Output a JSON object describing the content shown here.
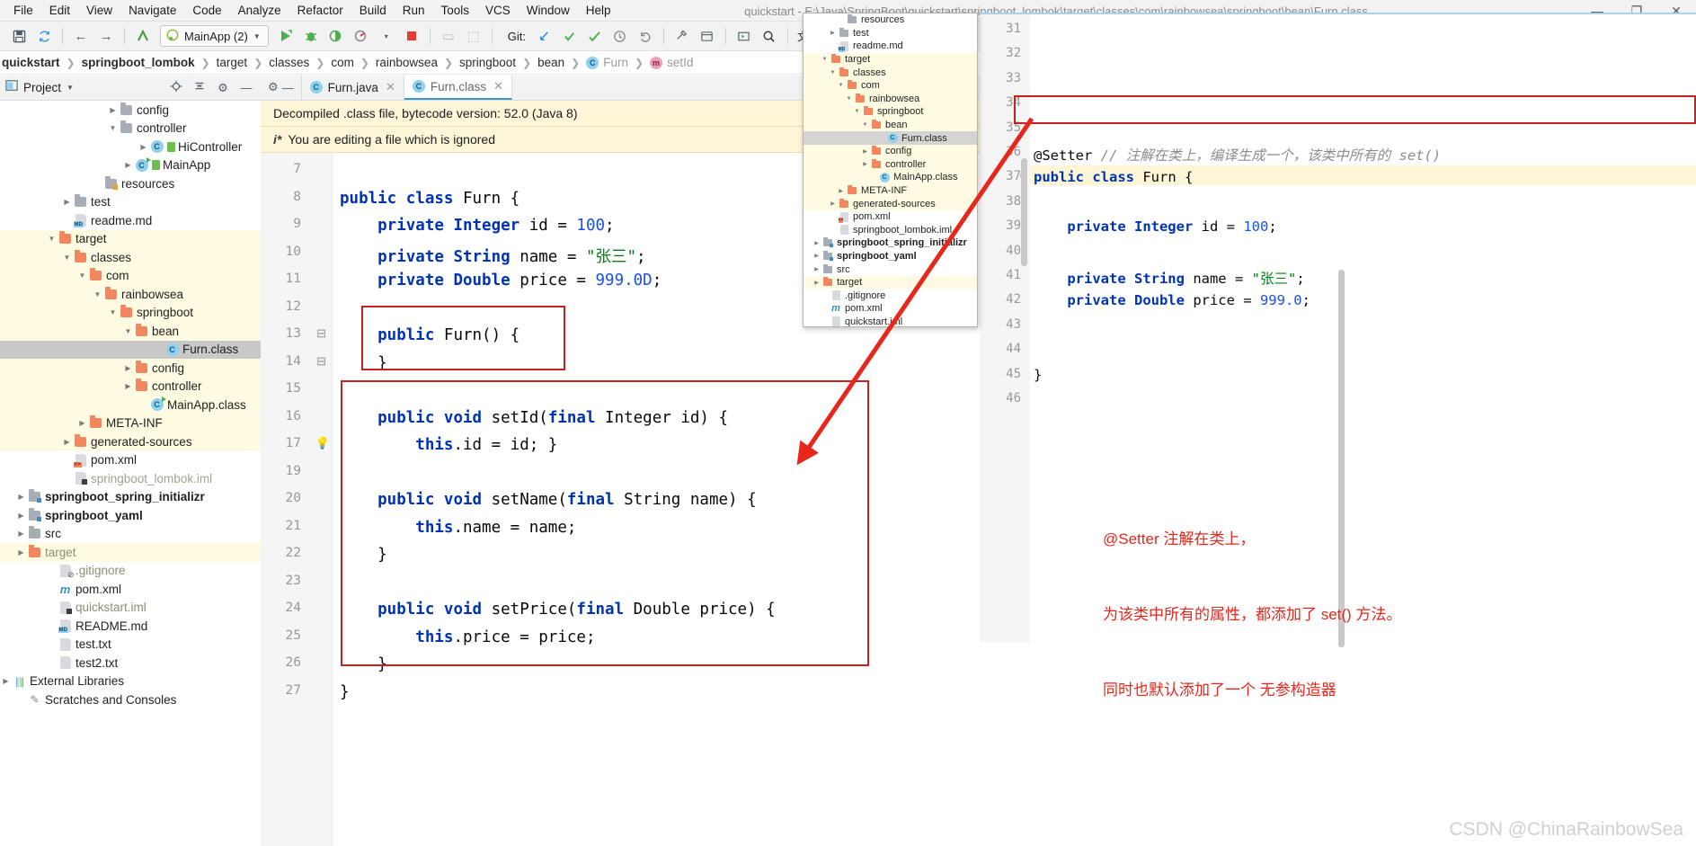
{
  "window": {
    "title": "quickstart - E:\\Java\\SpringBoot\\quickstart\\springboot_lombok\\target\\classes\\com\\rainbowsea\\springboot\\bean\\Furn.class",
    "minimize": "—",
    "maximize": "❐",
    "close": "✕"
  },
  "menubar": {
    "items": [
      {
        "label": "File"
      },
      {
        "label": "Edit"
      },
      {
        "label": "View"
      },
      {
        "label": "Navigate"
      },
      {
        "label": "Code"
      },
      {
        "label": "Analyze"
      },
      {
        "label": "Refactor"
      },
      {
        "label": "Build"
      },
      {
        "label": "Run"
      },
      {
        "label": "Tools"
      },
      {
        "label": "VCS"
      },
      {
        "label": "Window"
      },
      {
        "label": "Help"
      }
    ]
  },
  "toolbar": {
    "save_icon": "💾",
    "sync_icon": "↻",
    "back_icon": "←",
    "forward_icon": "→",
    "build_icon": "↖",
    "run_config": "MainApp (2)",
    "run_config_caret": "▼",
    "run_icon": "▶",
    "debug_icon": "🐞",
    "run_coverage_icon": "◑",
    "profile_icon": "◴",
    "profile_caret": "▾",
    "stop_icon": "■",
    "device_icon": "▭",
    "package_icon": "⬚",
    "git_label": "Git:",
    "git_update_icon": "↙",
    "git_commit_icon": "✓",
    "git_push_icon": "✔",
    "git_history_icon": "◷",
    "git_revert_icon": "↶",
    "search_everywhere_icon": "🔍",
    "settings_icon": "🔧",
    "layout_icon": "▤",
    "preview_icon": "▷",
    "translate_icon": "文"
  },
  "breadcrumb": {
    "items": [
      {
        "label": "quickstart",
        "bold": true,
        "icon": ""
      },
      {
        "label": "springboot_lombok",
        "bold": true,
        "icon": ""
      },
      {
        "label": "target",
        "bold": false,
        "icon": ""
      },
      {
        "label": "classes",
        "bold": false,
        "icon": ""
      },
      {
        "label": "com",
        "bold": false,
        "icon": ""
      },
      {
        "label": "rainbowsea",
        "bold": false,
        "icon": ""
      },
      {
        "label": "springboot",
        "bold": false,
        "icon": ""
      },
      {
        "label": "bean",
        "bold": false,
        "icon": ""
      },
      {
        "label": "Furn",
        "bold": false,
        "icon": "class-icon"
      },
      {
        "label": "setId",
        "bold": false,
        "icon": "method-icon"
      }
    ],
    "separator": "❯"
  },
  "sidebar": {
    "header": {
      "title": "Project",
      "caret": "▼",
      "locate_icon": "⊕",
      "collapse_icon": "⨍",
      "settings_icon": "⚙",
      "hide_icon": "—"
    },
    "items": [
      {
        "label": "config",
        "indent": 7,
        "arrow": "▶",
        "icon": "folder-gray",
        "hl": false
      },
      {
        "label": "controller",
        "indent": 7,
        "arrow": "▼",
        "icon": "folder-gray",
        "hl": false
      },
      {
        "label": "HiController",
        "indent": 9,
        "arrow": "▶",
        "icon": "class",
        "hl": false,
        "green": true
      },
      {
        "label": "MainApp",
        "indent": 8,
        "arrow": "▶",
        "icon": "class-run",
        "hl": false,
        "green": true
      },
      {
        "label": "resources",
        "indent": 6,
        "arrow": "",
        "icon": "folder-res",
        "hl": false
      },
      {
        "label": "test",
        "indent": 4,
        "arrow": "▶",
        "icon": "folder-gray",
        "hl": false
      },
      {
        "label": "readme.md",
        "indent": 4,
        "arrow": "",
        "icon": "doc-md",
        "hl": false
      },
      {
        "label": "target",
        "indent": 3,
        "arrow": "▼",
        "icon": "folder-orange",
        "hl": true
      },
      {
        "label": "classes",
        "indent": 4,
        "arrow": "▼",
        "icon": "folder-orange",
        "hl": true
      },
      {
        "label": "com",
        "indent": 5,
        "arrow": "▼",
        "icon": "folder-orange",
        "hl": true
      },
      {
        "label": "rainbowsea",
        "indent": 6,
        "arrow": "▼",
        "icon": "folder-orange",
        "hl": true
      },
      {
        "label": "springboot",
        "indent": 7,
        "arrow": "▼",
        "icon": "folder-orange",
        "hl": true
      },
      {
        "label": "bean",
        "indent": 8,
        "arrow": "▼",
        "icon": "folder-orange",
        "hl": true
      },
      {
        "label": "Furn.class",
        "indent": 10,
        "arrow": "",
        "icon": "class",
        "sel": true
      },
      {
        "label": "config",
        "indent": 8,
        "arrow": "▶",
        "icon": "folder-orange",
        "hl": true
      },
      {
        "label": "controller",
        "indent": 8,
        "arrow": "▶",
        "icon": "folder-orange",
        "hl": true
      },
      {
        "label": "MainApp.class",
        "indent": 9,
        "arrow": "",
        "icon": "class-run",
        "hl": true
      },
      {
        "label": "META-INF",
        "indent": 5,
        "arrow": "▶",
        "icon": "folder-orange",
        "hl": true
      },
      {
        "label": "generated-sources",
        "indent": 4,
        "arrow": "▶",
        "icon": "folder-orange",
        "hl": true
      },
      {
        "label": "pom.xml",
        "indent": 4,
        "arrow": "",
        "icon": "doc-xml",
        "hl": false
      },
      {
        "label": "springboot_lombok.iml",
        "indent": 4,
        "arrow": "",
        "icon": "doc-iml",
        "hl": false,
        "dim": true
      },
      {
        "label": "springboot_spring_initializr",
        "indent": 1,
        "arrow": "▶",
        "icon": "folder-mod",
        "hl": false,
        "bold": true
      },
      {
        "label": "springboot_yaml",
        "indent": 1,
        "arrow": "▶",
        "icon": "folder-mod",
        "hl": false,
        "bold": true
      },
      {
        "label": "src",
        "indent": 1,
        "arrow": "▶",
        "icon": "folder-gray",
        "hl": false
      },
      {
        "label": "target",
        "indent": 1,
        "arrow": "▶",
        "icon": "folder-orange",
        "hl": true,
        "gray": true
      },
      {
        "label": ".gitignore",
        "indent": 3,
        "arrow": "",
        "icon": "doc-git",
        "hl": false,
        "gray": true
      },
      {
        "label": "pom.xml",
        "indent": 3,
        "arrow": "",
        "icon": "maven",
        "hl": false
      },
      {
        "label": "quickstart.iml",
        "indent": 3,
        "arrow": "",
        "icon": "doc-iml",
        "hl": false,
        "gray": true
      },
      {
        "label": "README.md",
        "indent": 3,
        "arrow": "",
        "icon": "doc-md",
        "hl": false
      },
      {
        "label": "test.txt",
        "indent": 3,
        "arrow": "",
        "icon": "doc-txt",
        "hl": false
      },
      {
        "label": "test2.txt",
        "indent": 3,
        "arrow": "",
        "icon": "doc-txt",
        "hl": false
      },
      {
        "label": "External Libraries",
        "indent": 0,
        "arrow": "▶",
        "icon": "library",
        "hl": false
      },
      {
        "label": "Scratches and Consoles",
        "indent": 1,
        "arrow": "",
        "icon": "scratch",
        "hl": false
      }
    ]
  },
  "editor": {
    "tabs": [
      {
        "label": "Furn.java",
        "icon": "class-icon",
        "active": false,
        "close": "✕"
      },
      {
        "label": "Furn.class",
        "icon": "class-icon",
        "active": true,
        "close": "✕"
      }
    ],
    "banners": [
      {
        "text": "Decompiled .class file, bytecode version: 52.0 (Java 8)",
        "icon": ""
      },
      {
        "text": "You are editing a file which is ignored",
        "icon": "i*"
      }
    ],
    "line_numbers": [
      "7",
      "8",
      "9",
      "10",
      "11",
      "12",
      "13",
      "14",
      "15",
      "16",
      "17",
      "19",
      "20",
      "21",
      "22",
      "23",
      "24",
      "25",
      "26",
      "27"
    ],
    "code_lines": [
      {
        "n": "7",
        "text": "",
        "tokens": []
      },
      {
        "n": "8",
        "tokens": [
          {
            "t": "public ",
            "c": "kw"
          },
          {
            "t": "class ",
            "c": "kw"
          },
          {
            "t": "Furn {",
            "c": "mth"
          }
        ]
      },
      {
        "n": "9",
        "tokens": [
          {
            "t": "    private ",
            "c": "kw"
          },
          {
            "t": "Integer ",
            "c": "kw"
          },
          {
            "t": "id = ",
            "c": "mth"
          },
          {
            "t": "100",
            "c": "num"
          },
          {
            "t": ";",
            "c": "mth"
          }
        ]
      },
      {
        "n": "10",
        "tokens": [
          {
            "t": "    private ",
            "c": "kw"
          },
          {
            "t": "String ",
            "c": "kw"
          },
          {
            "t": "name = ",
            "c": "mth"
          },
          {
            "t": "\"张三\"",
            "c": "str"
          },
          {
            "t": ";",
            "c": "mth"
          }
        ]
      },
      {
        "n": "11",
        "tokens": [
          {
            "t": "    private ",
            "c": "kw"
          },
          {
            "t": "Double ",
            "c": "kw"
          },
          {
            "t": "price = ",
            "c": "mth"
          },
          {
            "t": "999.0D",
            "c": "num"
          },
          {
            "t": ";",
            "c": "mth"
          }
        ]
      },
      {
        "n": "12",
        "tokens": []
      },
      {
        "n": "13",
        "tokens": [
          {
            "t": "    public ",
            "c": "kw"
          },
          {
            "t": "Furn() {",
            "c": "mth"
          }
        ]
      },
      {
        "n": "14",
        "tokens": [
          {
            "t": "    }",
            "c": "mth"
          }
        ]
      },
      {
        "n": "15",
        "tokens": []
      },
      {
        "n": "16",
        "tokens": [
          {
            "t": "    public ",
            "c": "kw"
          },
          {
            "t": "void ",
            "c": "kw"
          },
          {
            "t": "setId(",
            "c": "mth"
          },
          {
            "t": "final ",
            "c": "kw"
          },
          {
            "t": "Integer ",
            "c": "mth"
          },
          {
            "t": "id) {",
            "c": "mth"
          }
        ]
      },
      {
        "n": "17",
        "tokens": [
          {
            "t": "        this",
            "c": "kw"
          },
          {
            "t": ".id = id; }",
            "c": "mth"
          }
        ]
      },
      {
        "n": "19",
        "tokens": []
      },
      {
        "n": "20",
        "tokens": [
          {
            "t": "    public ",
            "c": "kw"
          },
          {
            "t": "void ",
            "c": "kw"
          },
          {
            "t": "setName(",
            "c": "mth"
          },
          {
            "t": "final ",
            "c": "kw"
          },
          {
            "t": "String ",
            "c": "mth"
          },
          {
            "t": "name) {",
            "c": "mth"
          }
        ]
      },
      {
        "n": "21",
        "tokens": [
          {
            "t": "        this",
            "c": "kw"
          },
          {
            "t": ".name = name;",
            "c": "mth"
          }
        ]
      },
      {
        "n": "22",
        "tokens": [
          {
            "t": "    }",
            "c": "mth"
          }
        ]
      },
      {
        "n": "23",
        "tokens": []
      },
      {
        "n": "24",
        "tokens": [
          {
            "t": "    public ",
            "c": "kw"
          },
          {
            "t": "void ",
            "c": "kw"
          },
          {
            "t": "setPrice(",
            "c": "mth"
          },
          {
            "t": "final ",
            "c": "kw"
          },
          {
            "t": "Double ",
            "c": "mth"
          },
          {
            "t": "price) {",
            "c": "mth"
          }
        ]
      },
      {
        "n": "25",
        "tokens": [
          {
            "t": "        this",
            "c": "kw"
          },
          {
            "t": ".price = price;",
            "c": "mth"
          }
        ]
      },
      {
        "n": "26",
        "tokens": [
          {
            "t": "    }",
            "c": "mth"
          }
        ]
      },
      {
        "n": "27",
        "tokens": [
          {
            "t": "}",
            "c": "mth"
          }
        ]
      }
    ],
    "bulb_icon": "💡"
  },
  "popup_tree": {
    "items": [
      {
        "label": "resources",
        "indent": 4,
        "arrow": "",
        "icon": "folder-res",
        "hl": false
      },
      {
        "label": "test",
        "indent": 3,
        "arrow": "▶",
        "icon": "folder-gray",
        "hl": false
      },
      {
        "label": "readme.md",
        "indent": 3,
        "arrow": "",
        "icon": "doc-md",
        "hl": false
      },
      {
        "label": "target",
        "indent": 2,
        "arrow": "▼",
        "icon": "folder-orange",
        "hl": true
      },
      {
        "label": "classes",
        "indent": 3,
        "arrow": "▼",
        "icon": "folder-orange",
        "hl": true
      },
      {
        "label": "com",
        "indent": 4,
        "arrow": "▼",
        "icon": "folder-orange",
        "hl": true
      },
      {
        "label": "rainbowsea",
        "indent": 5,
        "arrow": "▼",
        "icon": "folder-orange",
        "hl": true
      },
      {
        "label": "springboot",
        "indent": 6,
        "arrow": "▼",
        "icon": "folder-orange",
        "hl": true
      },
      {
        "label": "bean",
        "indent": 7,
        "arrow": "▼",
        "icon": "folder-orange",
        "hl": true
      },
      {
        "label": "Furn.class",
        "indent": 9,
        "arrow": "",
        "icon": "class",
        "sel": true
      },
      {
        "label": "config",
        "indent": 7,
        "arrow": "▶",
        "icon": "folder-orange",
        "hl": true
      },
      {
        "label": "controller",
        "indent": 7,
        "arrow": "▶",
        "icon": "folder-orange",
        "hl": true
      },
      {
        "label": "MainApp.class",
        "indent": 8,
        "arrow": "",
        "icon": "class-run",
        "hl": true
      },
      {
        "label": "META-INF",
        "indent": 4,
        "arrow": "▶",
        "icon": "folder-orange",
        "hl": true
      },
      {
        "label": "generated-sources",
        "indent": 3,
        "arrow": "▶",
        "icon": "folder-orange",
        "hl": true
      },
      {
        "label": "pom.xml",
        "indent": 3,
        "arrow": "",
        "icon": "doc-xml",
        "hl": false
      },
      {
        "label": "springboot_lombok.iml",
        "indent": 3,
        "arrow": "",
        "icon": "doc-iml",
        "hl": false
      },
      {
        "label": "springboot_spring_initializr",
        "indent": 1,
        "arrow": "▶",
        "icon": "folder-mod",
        "hl": false,
        "bold": true
      },
      {
        "label": "springboot_yaml",
        "indent": 1,
        "arrow": "▶",
        "icon": "folder-mod",
        "hl": false,
        "bold": true
      },
      {
        "label": "src",
        "indent": 1,
        "arrow": "▶",
        "icon": "folder-gray",
        "hl": false
      },
      {
        "label": "target",
        "indent": 1,
        "arrow": "▶",
        "icon": "folder-orange",
        "hl": true
      },
      {
        "label": ".gitignore",
        "indent": 2,
        "arrow": "",
        "icon": "doc-git",
        "hl": false
      },
      {
        "label": "pom.xml",
        "indent": 2,
        "arrow": "",
        "icon": "maven",
        "hl": false
      },
      {
        "label": "quickstart.iml",
        "indent": 2,
        "arrow": "",
        "icon": "doc-iml",
        "hl": false
      }
    ]
  },
  "right_panel": {
    "line_numbers": [
      "31",
      "32",
      "33",
      "34",
      "35",
      "36",
      "37",
      "38",
      "39",
      "40",
      "41",
      "42",
      "43",
      "44",
      "45",
      "46"
    ],
    "code_lines": [
      {
        "n": "36",
        "tokens": [
          {
            "t": "@Setter ",
            "c": "mth"
          },
          {
            "t": "// 注解在类上，编译生成一个，该类中所有的 set()",
            "c": "cmt"
          }
        ]
      },
      {
        "n": "37",
        "tokens": [
          {
            "t": "public ",
            "c": "kw"
          },
          {
            "t": "class ",
            "c": "kw"
          },
          {
            "t": "Furn {",
            "c": "mth"
          }
        ]
      },
      {
        "n": "39",
        "tokens": [
          {
            "t": "    private ",
            "c": "kw"
          },
          {
            "t": "Integer ",
            "c": "kw"
          },
          {
            "t": "id = ",
            "c": "mth"
          },
          {
            "t": "100",
            "c": "num"
          },
          {
            "t": ";",
            "c": "mth"
          }
        ]
      },
      {
        "n": "41",
        "tokens": [
          {
            "t": "    private ",
            "c": "kw"
          },
          {
            "t": "String ",
            "c": "kw"
          },
          {
            "t": "name = ",
            "c": "mth"
          },
          {
            "t": "\"张三\"",
            "c": "str"
          },
          {
            "t": ";",
            "c": "mth"
          }
        ]
      },
      {
        "n": "42",
        "tokens": [
          {
            "t": "    private ",
            "c": "kw"
          },
          {
            "t": "Double ",
            "c": "kw"
          },
          {
            "t": "price = ",
            "c": "mth"
          },
          {
            "t": "999.0",
            "c": "num"
          },
          {
            "t": ";",
            "c": "mth"
          }
        ]
      },
      {
        "n": "45",
        "tokens": [
          {
            "t": "}",
            "c": "mth"
          }
        ]
      }
    ]
  },
  "annotation": {
    "lines": [
      "@Setter 注解在类上，",
      "为该类中所有的属性，都添加了 set() 方法。",
      "同时也默认添加了一个 无参构造器"
    ],
    "color": "#e8261c"
  },
  "watermark": "CSDN @ChinaRainbowSea",
  "colors": {
    "accent": "#3b95d3",
    "highlight_row": "#fffbe2",
    "selected_row": "#c8c8c8",
    "banner_bg": "#fdf6d8",
    "annotation_red": "#e8261c",
    "folder_orange": "#f2865e",
    "folder_gray": "#a6adb4"
  }
}
